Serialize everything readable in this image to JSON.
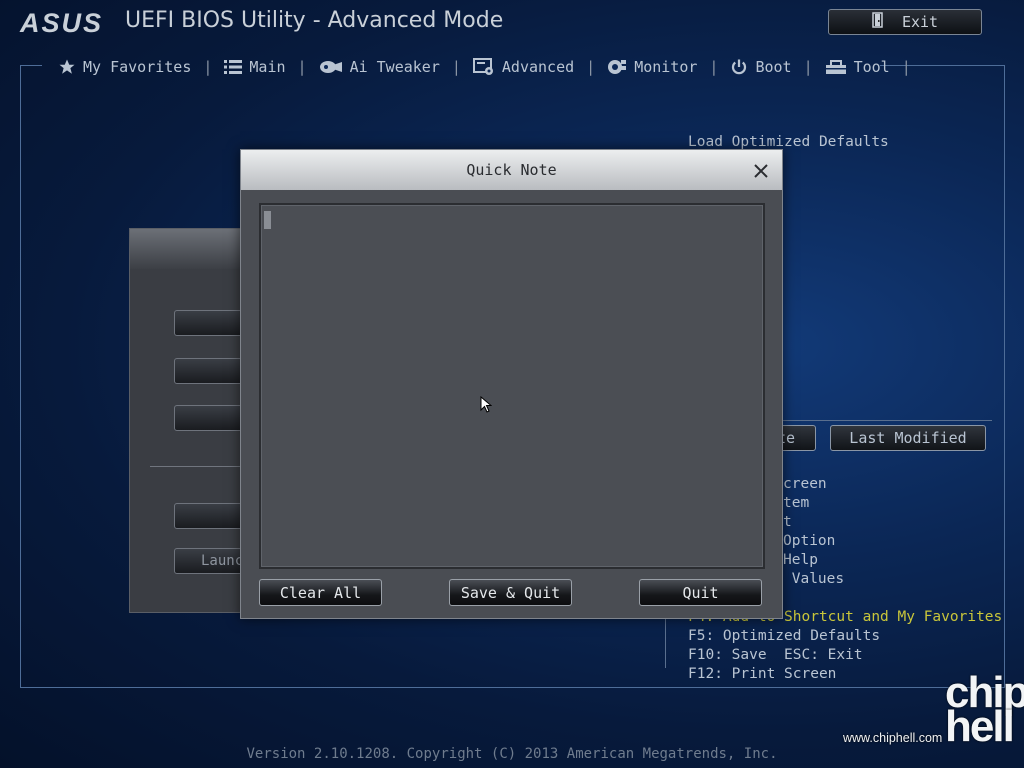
{
  "header": {
    "logo": "ASUS",
    "title": "UEFI BIOS Utility - Advanced Mode",
    "exit_label": "Exit"
  },
  "nav": {
    "items": [
      {
        "label": "My Favorites",
        "icon": "star-icon"
      },
      {
        "label": "Main",
        "icon": "list-icon"
      },
      {
        "label": "Ai Tweaker",
        "icon": "tweaker-icon"
      },
      {
        "label": "Advanced",
        "icon": "advanced-icon"
      },
      {
        "label": "Monitor",
        "icon": "monitor-icon"
      },
      {
        "label": "Boot",
        "icon": "power-icon"
      },
      {
        "label": "Tool",
        "icon": "tool-icon"
      }
    ],
    "separator": "|"
  },
  "right_panel": {
    "load_defaults": "Load Optimized Defaults",
    "button_partial": "te",
    "last_modified": "Last Modified",
    "hint_lines_partial": [
      "creen",
      "tem",
      "t",
      "Option",
      "Help",
      " Values"
    ],
    "hint_yellow": "F4: Add to Shortcut and My Favorites",
    "hint_f5": "F5: Optimized Defaults",
    "hint_f10": "F10: Save  ESC: Exit",
    "hint_f12": "F12: Print Screen"
  },
  "background_dialog": {
    "launch_partial": "Launc"
  },
  "quick_note": {
    "title": "Quick Note",
    "content": "",
    "clear_all": "Clear All",
    "save_quit": "Save & Quit",
    "quit": "Quit"
  },
  "footer": {
    "version": "Version 2.10.1208. Copyright (C) 2013 American Megatrends, Inc."
  },
  "watermark": {
    "logo": "chip hell",
    "url": "www.chiphell.com"
  },
  "colors": {
    "background": "#0b2756",
    "text": "#b9c4d2",
    "hint_highlight": "#c9c63a",
    "modal_body": "#4a4d53",
    "modal_titlebar": "#dfe1e3"
  }
}
